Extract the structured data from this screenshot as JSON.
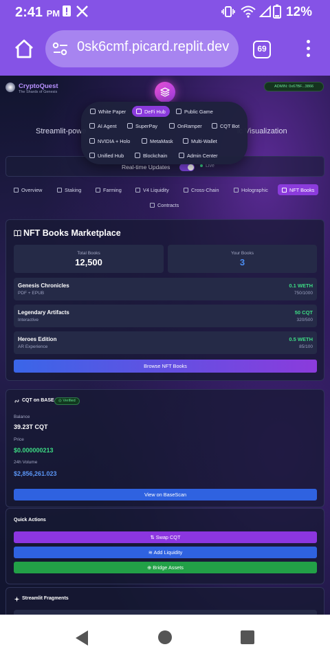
{
  "status_bar": {
    "time": "2:41",
    "ampm": "PM",
    "battery": "12%"
  },
  "browser": {
    "url": "0sk6cmf.picard.replit.dev",
    "tab_count": "69"
  },
  "header": {
    "brand": "CryptoQuest",
    "brand_sub": "The Shards of Genesis",
    "admin_badge": "ADMIN: 0x67BF...3866",
    "subtitle_left": "Streamlit-powe",
    "subtitle_right": "ic Visualization"
  },
  "menu": {
    "items": [
      {
        "label": "White Paper",
        "active": false
      },
      {
        "label": "DeFi Hub",
        "active": true
      },
      {
        "label": "Public Game",
        "active": false
      },
      {
        "label": "AI Agent",
        "active": false
      },
      {
        "label": "SuperPay",
        "active": false
      },
      {
        "label": "OnRamper",
        "active": false
      },
      {
        "label": "CQT Bot",
        "active": false
      },
      {
        "label": "NVIDIA + Holo",
        "active": false
      },
      {
        "label": "MetaMask",
        "active": false
      },
      {
        "label": "Multi-Wallet",
        "active": false
      },
      {
        "label": "Unified Hub",
        "active": false
      },
      {
        "label": "Blockchain",
        "active": false
      },
      {
        "label": "Admin Center",
        "active": false
      }
    ]
  },
  "realtime": {
    "label": "Real-time Updates",
    "live": "Live"
  },
  "tabs": [
    {
      "label": "Overview"
    },
    {
      "label": "Staking"
    },
    {
      "label": "Farming"
    },
    {
      "label": "V4 Liquidity"
    },
    {
      "label": "Cross-Chain"
    },
    {
      "label": "Holographic"
    },
    {
      "label": "NFT Books"
    },
    {
      "label": "Contracts"
    }
  ],
  "nft": {
    "title": "NFT Books Marketplace",
    "total_label": "Total Books",
    "total_value": "12,500",
    "your_label": "Your Books",
    "your_value": "3",
    "books": [
      {
        "title": "Genesis Chronicles",
        "format": "PDF + EPUB",
        "price": "0.1 WETH",
        "count": "750/1000"
      },
      {
        "title": "Legendary Artifacts",
        "format": "Interactive",
        "price": "50 CQT",
        "count": "320/500"
      },
      {
        "title": "Heroes Edition",
        "format": "AR Experience",
        "price": "0.5 WETH",
        "count": "85/100"
      }
    ],
    "browse_button": "Browse NFT Books"
  },
  "cqt": {
    "title": "CQT on BASE",
    "verified": "Verified",
    "balance_label": "Balance",
    "balance_value": "39.23T CQT",
    "price_label": "Price",
    "price_value": "$0.000000213",
    "volume_label": "24h Volume",
    "volume_value": "$2,856,261.023",
    "basescan_button": "View on BaseScan"
  },
  "quick_actions": {
    "title": "Quick Actions",
    "swap": "Swap CQT",
    "liquidity": "Add Liquidity",
    "bridge": "Bridge Assets"
  },
  "fragments": {
    "title": "Streamlit Fragments"
  },
  "colors": {
    "accent": "#8b3bdc",
    "chrome": "#8553e6",
    "green": "#3ddc84",
    "blue": "#2f62e0"
  }
}
